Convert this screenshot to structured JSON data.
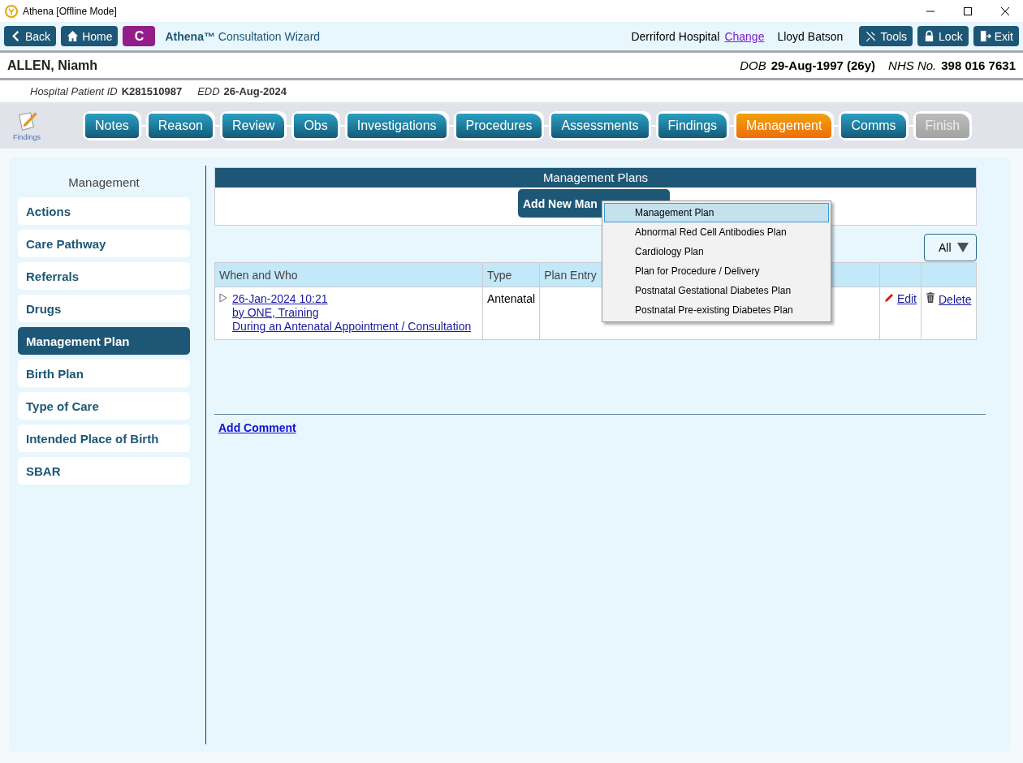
{
  "window": {
    "title": "Athena [Offline Mode]"
  },
  "toolbar": {
    "back": "Back",
    "home": "Home",
    "mode_badge": "C",
    "app_title": "**Athena™** Consultation Wizard",
    "location": "Derriford Hospital",
    "change_link": "Change",
    "user": "Lloyd Batson",
    "tools": "Tools",
    "lock": "Lock",
    "exit": "Exit"
  },
  "patient": {
    "name": "ALLEN, Niamh",
    "dob_label": "DOB",
    "dob": "29-Aug-1997 (26y)",
    "nhs_label": "NHS No.",
    "nhs": "398 016 7631",
    "hospital_id_label": "Hospital Patient ID",
    "hospital_id": "K281510987",
    "edd_label": "EDD",
    "edd": "26-Aug-2024"
  },
  "wizard": {
    "current_icon_label": "Findings",
    "steps": [
      {
        "label": "Notes",
        "selected": false,
        "disabled": false
      },
      {
        "label": "Reason",
        "selected": false,
        "disabled": false
      },
      {
        "label": "Review",
        "selected": false,
        "disabled": false
      },
      {
        "label": "Obs",
        "selected": false,
        "disabled": false
      },
      {
        "label": "Investigations",
        "selected": false,
        "disabled": false
      },
      {
        "label": "Procedures",
        "selected": false,
        "disabled": false
      },
      {
        "label": "Assessments",
        "selected": false,
        "disabled": false
      },
      {
        "label": "Findings",
        "selected": false,
        "disabled": false
      },
      {
        "label": "Management",
        "selected": true,
        "disabled": false
      },
      {
        "label": "Comms",
        "selected": false,
        "disabled": false
      },
      {
        "label": "Finish",
        "selected": false,
        "disabled": true
      }
    ]
  },
  "sidebar": {
    "title": "Management",
    "items": [
      {
        "label": "Actions",
        "selected": false
      },
      {
        "label": "Care Pathway",
        "selected": false
      },
      {
        "label": "Referrals",
        "selected": false
      },
      {
        "label": "Drugs",
        "selected": false
      },
      {
        "label": "Management Plan",
        "selected": true
      },
      {
        "label": "Birth Plan",
        "selected": false
      },
      {
        "label": "Type of Care",
        "selected": false
      },
      {
        "label": "Intended Place of Birth",
        "selected": false
      },
      {
        "label": "SBAR",
        "selected": false
      }
    ]
  },
  "plans": {
    "title": "Management Plans",
    "add_button": "Add New Man",
    "filter": "All",
    "columns": [
      "When and Who",
      "Type",
      "Plan Entry"
    ],
    "rows": [
      {
        "when": "26-Jan-2024 10:21",
        "who": "by ONE, Training",
        "context": "During an Antenatal Appointment / Consultation",
        "type": "Antenatal",
        "edit": "Edit",
        "delete": "Delete"
      }
    ],
    "add_comment": "Add Comment"
  },
  "add_menu": {
    "items": [
      {
        "label": "Management Plan",
        "selected": true
      },
      {
        "label": "Abnormal Red Cell Antibodies Plan",
        "selected": false
      },
      {
        "label": "Cardiology Plan",
        "selected": false
      },
      {
        "label": "Plan for Procedure / Delivery",
        "selected": false
      },
      {
        "label": "Postnatal Gestational Diabetes Plan",
        "selected": false
      },
      {
        "label": "Postnatal Pre-existing Diabetes Plan",
        "selected": false
      }
    ]
  }
}
